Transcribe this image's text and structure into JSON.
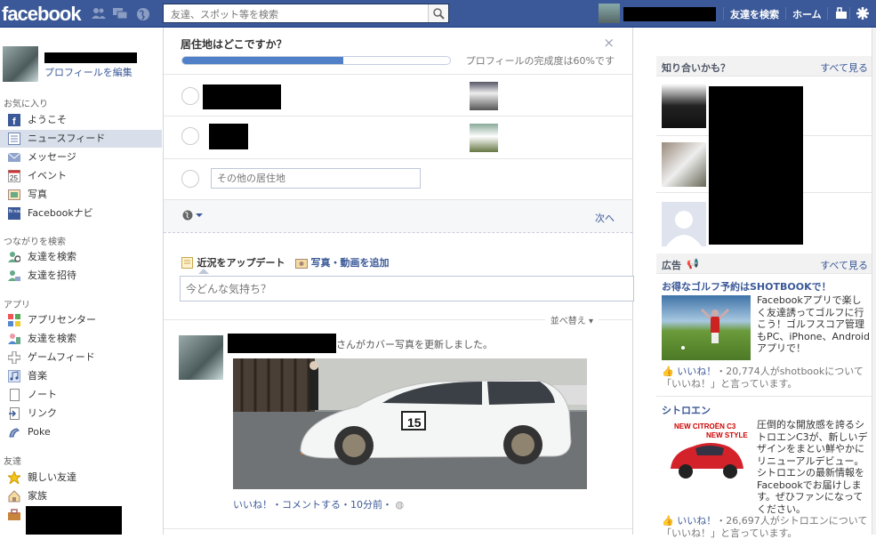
{
  "topbar": {
    "logo": "facebook",
    "search_placeholder": "友達、スポット等を検索",
    "links": [
      "友達を検索",
      "ホーム"
    ]
  },
  "left": {
    "profile_edit": "プロフィールを編集",
    "sections": [
      {
        "title": "お気に入り",
        "items": [
          "ようこそ",
          "ニュースフィード",
          "メッセージ",
          "イベント",
          "写真",
          "Facebookナビ"
        ]
      },
      {
        "title": "つながりを検索",
        "items": [
          "友達を検索",
          "友達を招待"
        ]
      },
      {
        "title": "アプリ",
        "items": [
          "アプリセンター",
          "友達を検索",
          "ゲームフィード",
          "音楽",
          "ノート",
          "リンク",
          "Poke"
        ]
      },
      {
        "title": "友達",
        "items": [
          "親しい友達",
          "家族"
        ]
      }
    ],
    "event_day": "25",
    "navi_icon": "fb navi"
  },
  "residence": {
    "title": "居住地はどこですか？",
    "progress": 0.6,
    "progress_text": "プロフィールの完成度は60%です",
    "other_placeholder": "その他の居住地",
    "next": "次へ"
  },
  "composer": {
    "update_status": "近況をアップデート",
    "add_photo": "写真・動画を追加",
    "placeholder": "今どんな気持ち？",
    "sort": "並べ替え"
  },
  "story": {
    "text": "さんがカバー写真を更新しました。",
    "plate": "15",
    "actions": "いいね！・コメントする・10分前・"
  },
  "right": {
    "pymk_title": "知り合いかも？",
    "see_all": "すべて見る",
    "ads_title": "広告",
    "ads": [
      {
        "title": "お得なゴルフ予約はSHOTBOOKで！",
        "body": "Facebookアプリで楽しく友達誘ってゴルフに行こう！ゴルフスコア管理もPC、iPhone、Androidアプリで！",
        "likes_link": "いいね！",
        "likes_text": "・20,774人がshotbookについて「いいね！」と言っています。"
      },
      {
        "title": "シトロエン",
        "body": "圧倒的な開放感を誇るシトロエンC3が、新しいデザインをまとい鮮やかにリニューアルデビュー。シトロエンの最新情報をFacebookでお届けします。ぜひファンになってください。",
        "likes_link": "いいね！",
        "likes_text": "・26,697人がシトロエンについて「いいね！」と言っています。",
        "brand_line1": "NEW CITROËN C3",
        "brand_line2": "NEW STYLE"
      }
    ]
  },
  "colors": {
    "brand": "#3b5998",
    "accent_blue": "#4f80c8"
  }
}
